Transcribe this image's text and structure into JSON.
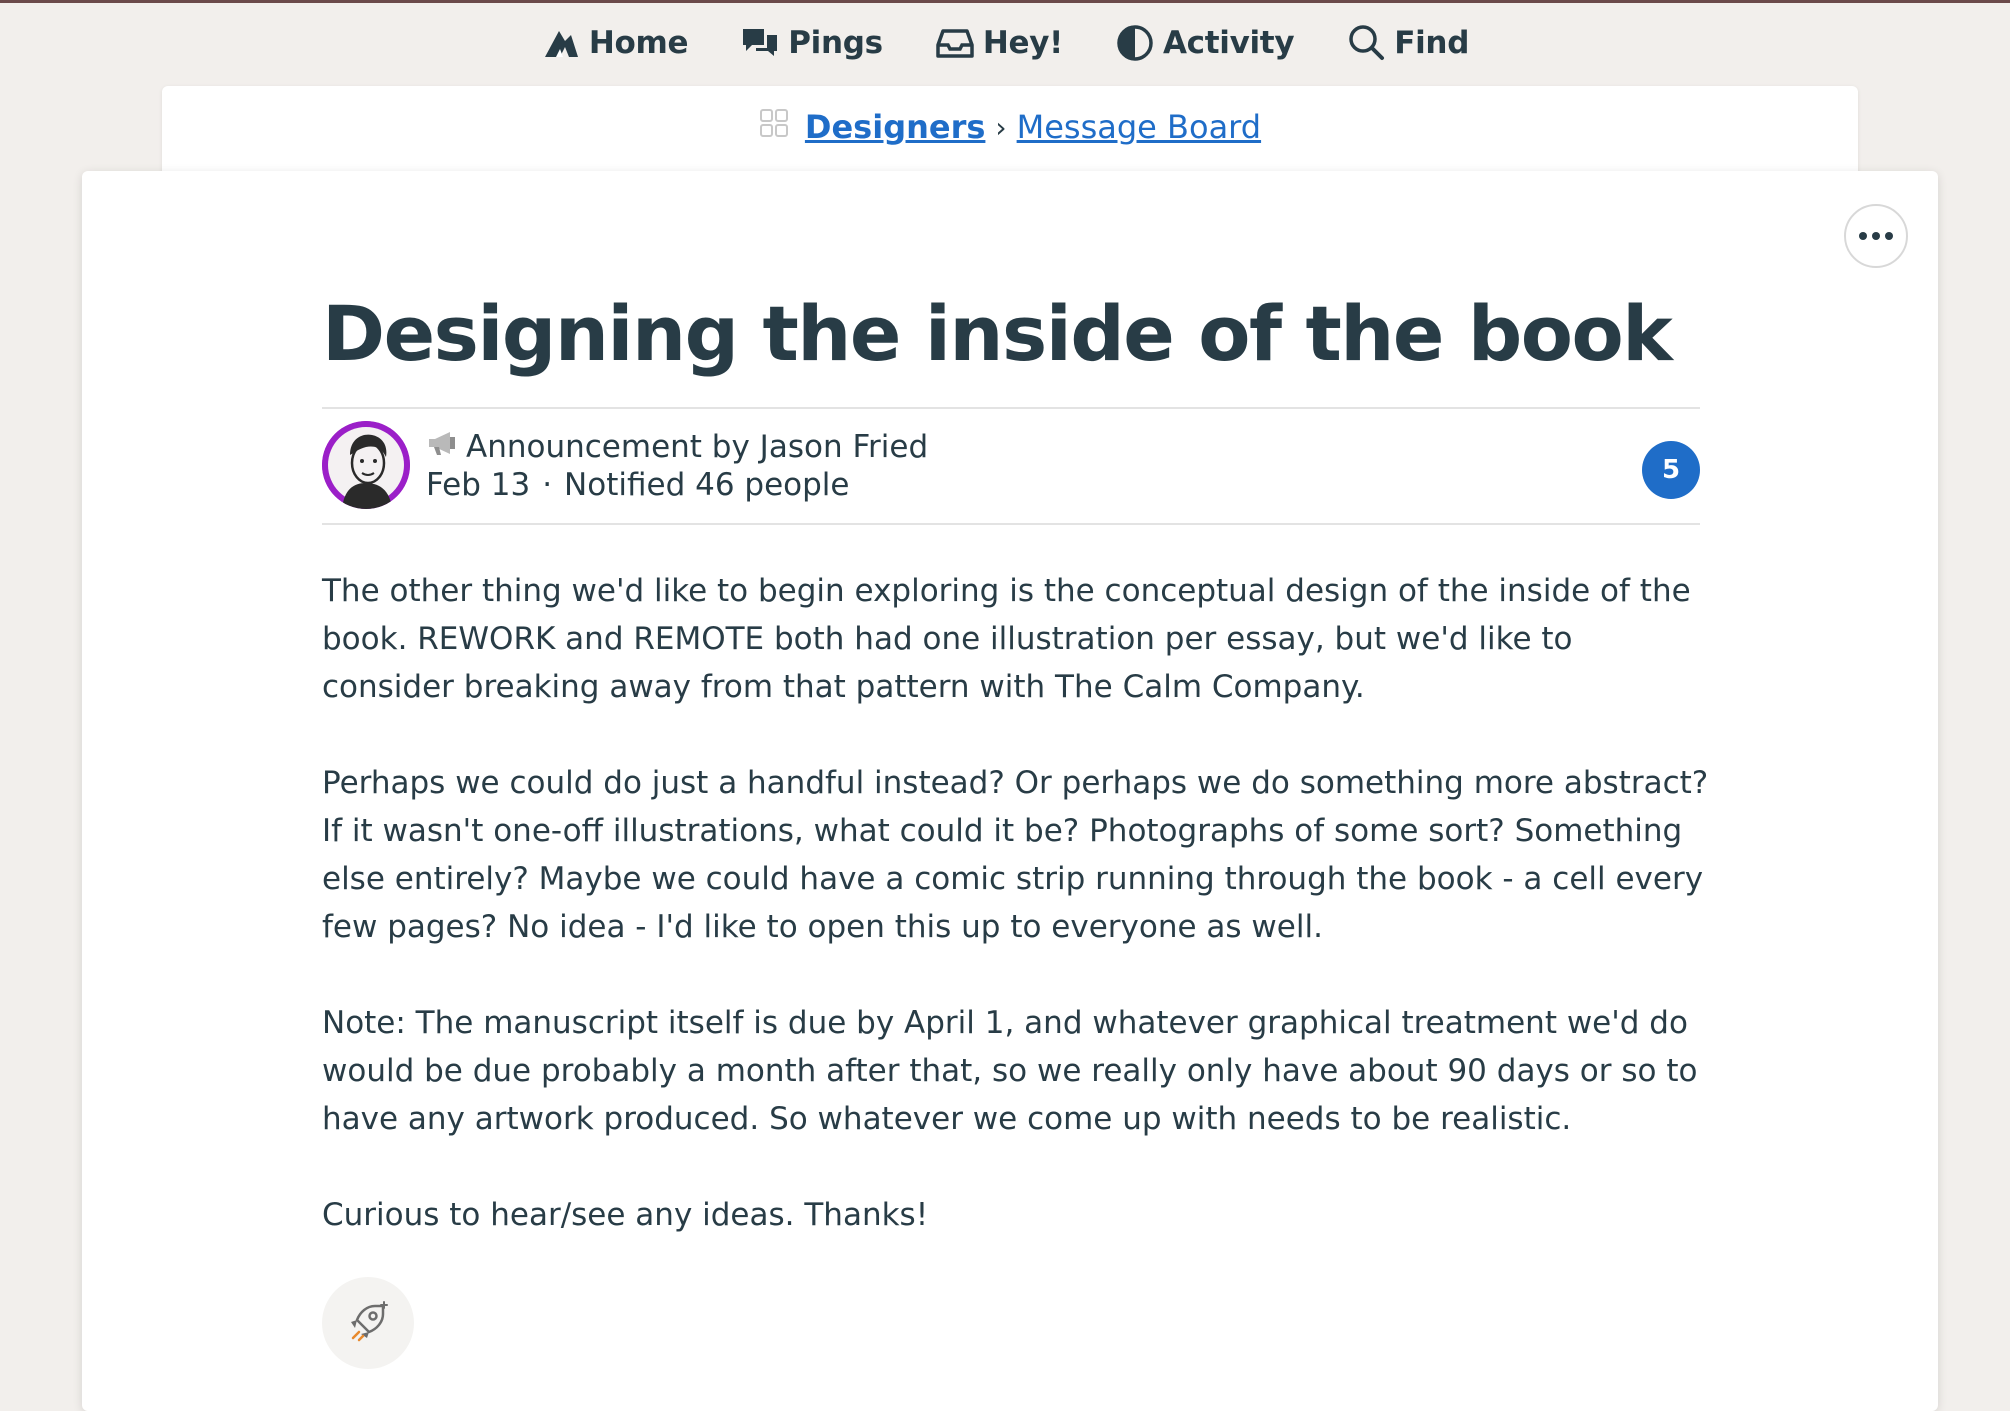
{
  "nav": {
    "items": [
      {
        "label": "Home",
        "icon": "home-icon"
      },
      {
        "label": "Pings",
        "icon": "pings-icon"
      },
      {
        "label": "Hey!",
        "icon": "inbox-icon"
      },
      {
        "label": "Activity",
        "icon": "activity-icon"
      },
      {
        "label": "Find",
        "icon": "search-icon"
      }
    ]
  },
  "breadcrumb": {
    "project": "Designers",
    "separator": "›",
    "section": "Message Board"
  },
  "message": {
    "title": "Designing the inside of the book",
    "category_icon": "megaphone-icon",
    "byline": "Announcement by Jason Fried",
    "date": "Feb 13",
    "separator": "·",
    "notified": "Notified 46 people",
    "comment_count": "5",
    "paragraphs": [
      "The other thing we'd like to begin exploring is the conceptual design of the inside of the book. REWORK and REMOTE both had one illustration per essay, but we'd like to consider breaking away from that pattern with The Calm Company.",
      "Perhaps we could do just a handful instead? Or perhaps we do something more abstract? If it wasn't one-off illustrations, what could it be? Photographs of some sort? Something else entirely? Maybe we could have a comic strip running through the book - a cell every few pages? No idea - I'd like to open this up to everyone as well.",
      "Note: The manuscript itself is due by April 1, and whatever graphical treatment we'd do would be due probably a month after that, so we really only have about 90 days or so to have any artwork produced. So whatever we come up with needs to be realistic.",
      "Curious to hear/see any ideas. Thanks!"
    ]
  },
  "colors": {
    "accent": "#1f6dc8",
    "text": "#283c46",
    "background": "#f2efec",
    "avatar_ring": "#9b1fc8"
  }
}
